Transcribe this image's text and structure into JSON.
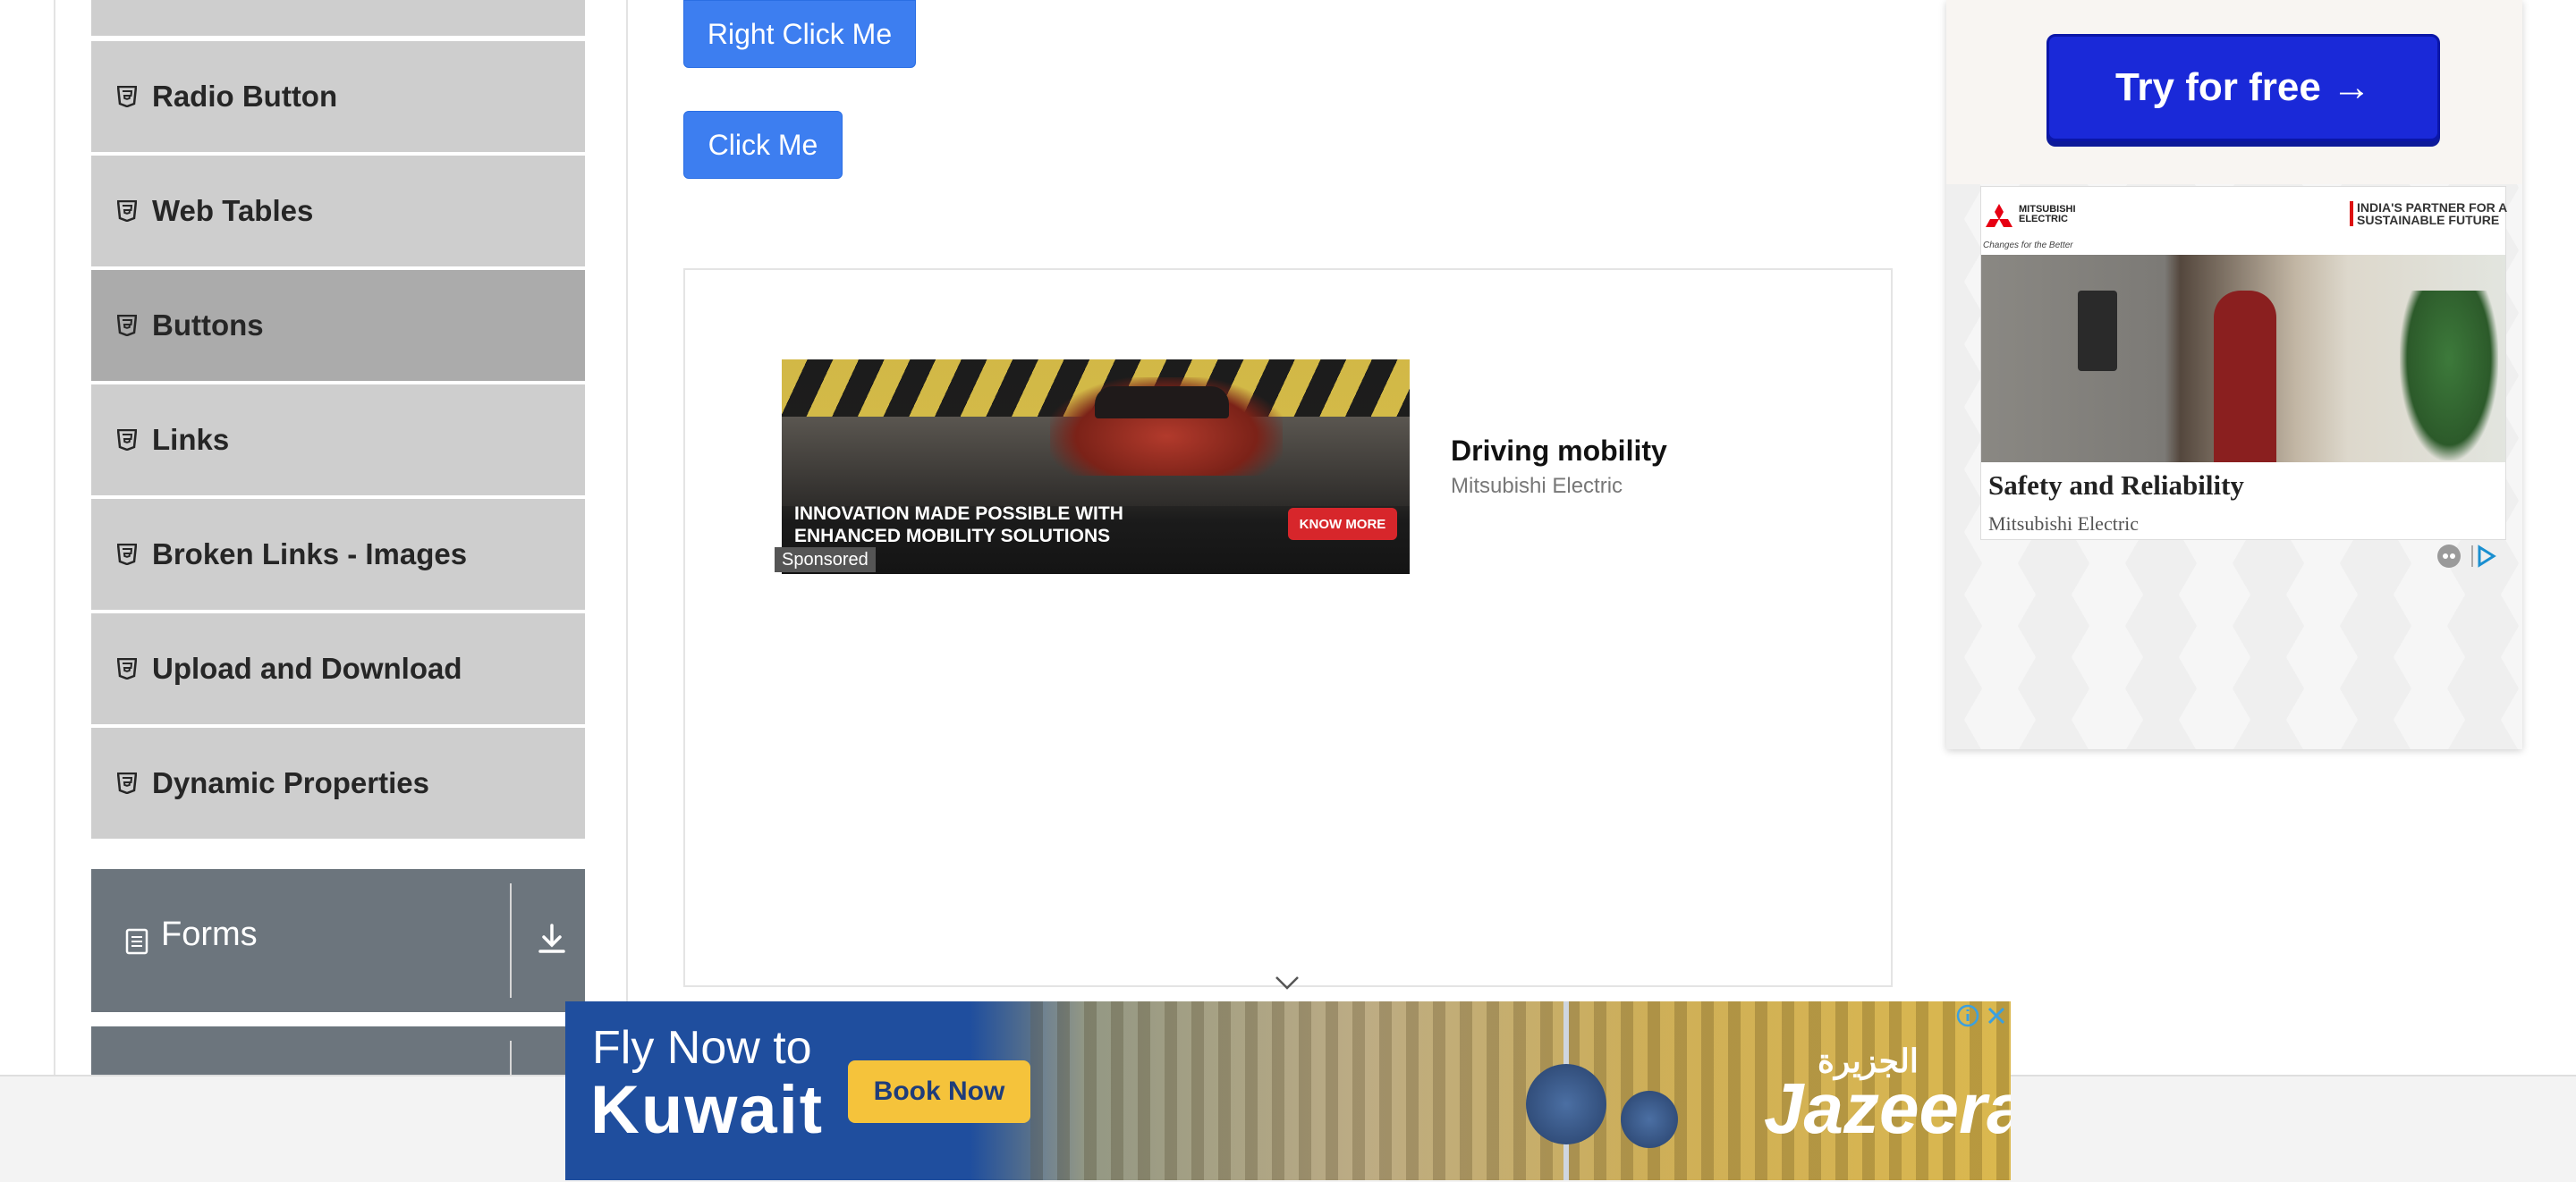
{
  "sidebar": {
    "items": [
      {
        "label": "Radio Button"
      },
      {
        "label": "Web Tables"
      },
      {
        "label": "Buttons"
      },
      {
        "label": "Links"
      },
      {
        "label": "Broken Links - Images"
      },
      {
        "label": "Upload and Download"
      },
      {
        "label": "Dynamic Properties"
      }
    ],
    "active_item": "Buttons",
    "group": {
      "label": "Forms"
    }
  },
  "main": {
    "right_click_label": "Right Click Me",
    "click_label": "Click Me"
  },
  "car_ad": {
    "headline": "INNOVATION MADE POSSIBLE WITH ENHANCED MOBILITY SOLUTIONS",
    "cta": "KNOW MORE",
    "sponsored": "Sponsored",
    "title": "Driving mobility",
    "advertiser": "Mitsubishi Electric"
  },
  "right_ad": {
    "cta": "Try for free →",
    "logo_text": "MITSUBISHI ELECTRIC",
    "tagline": "Changes for the Better",
    "partner_text": "INDIA'S PARTNER FOR A SUSTAINABLE FUTURE",
    "headline": "Safety and Reliability",
    "brand": "Mitsubishi Electric"
  },
  "bottom_ad": {
    "line1": "Fly Now to",
    "line2": "Kuwait",
    "cta": "Book Now",
    "brand_arabic": "الجزيرة",
    "brand": "Jazeera."
  },
  "colors": {
    "primary_button": "#3d7ef0",
    "sidebar_item": "#cecece",
    "sidebar_active": "#ababab",
    "group_header": "#6c757d"
  }
}
